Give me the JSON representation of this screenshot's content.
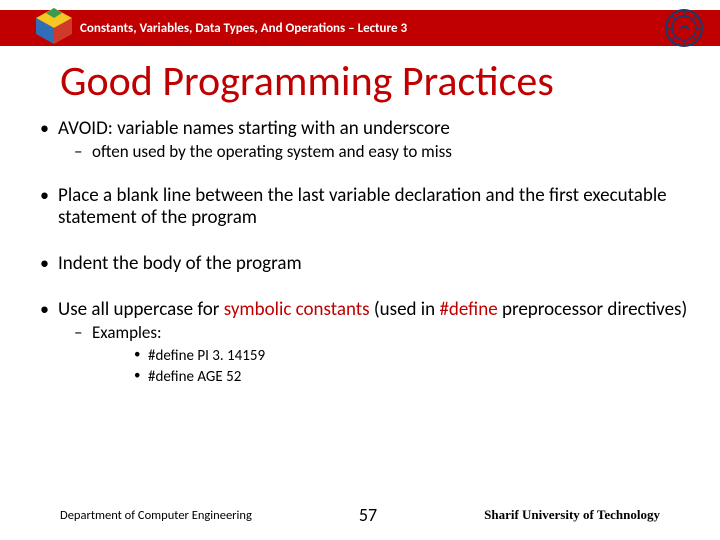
{
  "header": {
    "breadcrumb": "Constants, Variables, Data Types, And Operations – Lecture 3"
  },
  "title": "Good Programming Practices",
  "bullets": {
    "b1_text": "AVOID:  variable names starting with an underscore",
    "b1_sub": "often used by the operating system and easy to miss",
    "b2_text": "Place a blank line between the last variable declaration and the first executable statement of the program",
    "b3_text": "Indent the body of the program",
    "b4_pre": "Use all uppercase for ",
    "b4_red1": "symbolic constants",
    "b4_mid": "   (used in ",
    "b4_red2": "#define",
    "b4_post": " preprocessor directives)",
    "b4_sub_label": "Examples:",
    "ex1": "#define PI 3. 14159",
    "ex2": "#define AGE  52"
  },
  "footer": {
    "dept": "Department of Computer Engineering",
    "page": "57",
    "uni": "Sharif University of Technology"
  },
  "icons": {
    "left": "puzzle-cube-icon",
    "right": "seal-icon"
  }
}
